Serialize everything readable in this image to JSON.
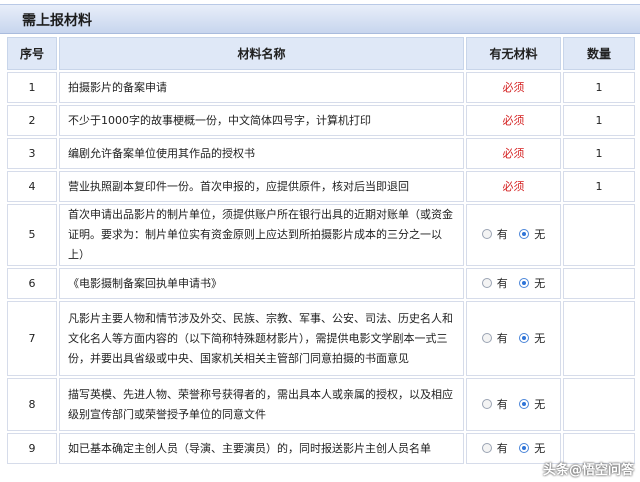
{
  "panel": {
    "title": "需上报材料"
  },
  "table": {
    "headers": [
      "序号",
      "材料名称",
      "有无材料",
      "数量"
    ],
    "rows": [
      {
        "no": "1",
        "name": "拍摄影片的备案申请",
        "status": "必须",
        "qty": "1"
      },
      {
        "no": "2",
        "name": "不少于1000字的故事梗概一份，中文简体四号字，计算机打印",
        "status": "必须",
        "qty": "1"
      },
      {
        "no": "3",
        "name": "编剧允许备案单位使用其作品的授权书",
        "status": "必须",
        "qty": "1"
      },
      {
        "no": "4",
        "name": "营业执照副本复印件一份。首次申报的，应提供原件，核对后当即退回",
        "status": "必须",
        "qty": "1"
      },
      {
        "no": "5",
        "name": "首次申请出品影片的制片单位，须提供账户所在银行出具的近期对账单（或资金证明。要求为：制片单位实有资金原则上应达到所拍摄影片成本的三分之一以上）",
        "opt_yes": "有",
        "opt_no": "无"
      },
      {
        "no": "6",
        "name": "《电影摄制备案回执单申请书》",
        "opt_yes": "有",
        "opt_no": "无"
      },
      {
        "no": "7",
        "name": "凡影片主要人物和情节涉及外交、民族、宗教、军事、公安、司法、历史名人和文化名人等方面内容的（以下简称特殊题材影片），需提供电影文学剧本一式三份，并要出具省级或中央、国家机关相关主管部门同意拍摄的书面意见",
        "opt_yes": "有",
        "opt_no": "无"
      },
      {
        "no": "8",
        "name": "描写英模、先进人物、荣誉称号获得者的，需出具本人或亲属的授权，以及相应级别宣传部门或荣誉授予单位的同意文件",
        "opt_yes": "有",
        "opt_no": "无"
      },
      {
        "no": "9",
        "name": "如已基本确定主创人员（导演、主要演员）的，同时报送影片主创人员名单",
        "opt_yes": "有",
        "opt_no": "无"
      }
    ]
  },
  "watermark": "头条@悟空问答"
}
